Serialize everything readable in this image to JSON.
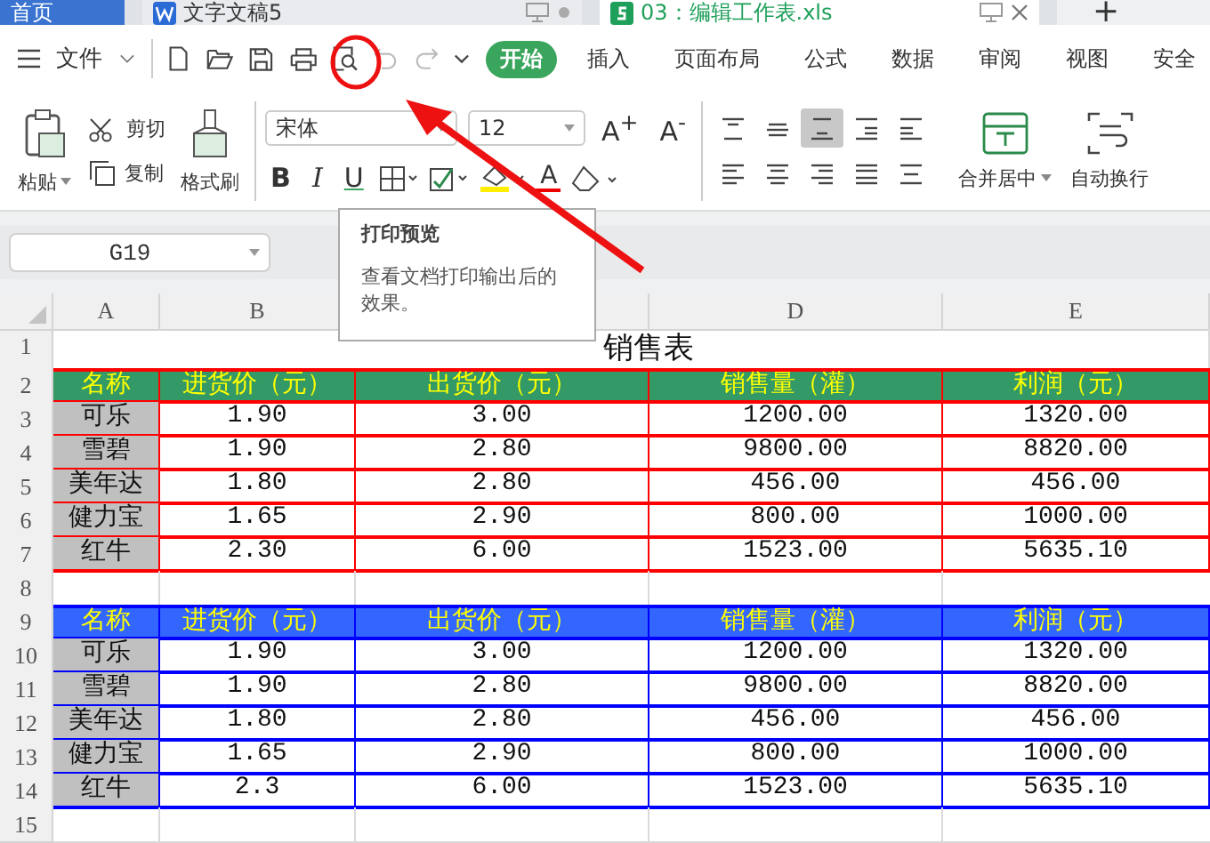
{
  "tabs": [
    {
      "label": "首页",
      "kind": "home",
      "selected": false
    },
    {
      "label": "文字文稿5",
      "kind": "writer",
      "selected": false
    },
    {
      "label": "03：编辑工作表.xls",
      "kind": "sheet",
      "selected": true
    }
  ],
  "new_tab": "+",
  "menu": {
    "label": "文件"
  },
  "ribbon_tabs": [
    {
      "label": "开始",
      "selected": true
    },
    {
      "label": "插入",
      "selected": false
    },
    {
      "label": "页面布局",
      "selected": false
    },
    {
      "label": "公式",
      "selected": false
    },
    {
      "label": "数据",
      "selected": false
    },
    {
      "label": "审阅",
      "selected": false
    },
    {
      "label": "视图",
      "selected": false
    },
    {
      "label": "安全",
      "selected": false
    }
  ],
  "clipboard": {
    "paste": "粘贴",
    "cut": "剪切",
    "copy": "复制",
    "format_painter": "格式刷"
  },
  "font": {
    "name": "宋体",
    "size": "12",
    "grow": "A$^{+}$",
    "shrink": "A$^{-}$",
    "bold": "B",
    "italic": "I",
    "underline": "U",
    "font_color": "A"
  },
  "align_buttons": [
    {
      "kind": "top",
      "selected": false
    },
    {
      "kind": "middle",
      "selected": false
    },
    {
      "kind": "bottom",
      "selected": true
    },
    {
      "kind": "outdent",
      "selected": false
    },
    {
      "kind": "indent",
      "selected": false
    },
    {
      "kind": "left",
      "selected": false
    },
    {
      "kind": "center",
      "selected": false
    },
    {
      "kind": "right",
      "selected": false
    },
    {
      "kind": "justify",
      "selected": false
    },
    {
      "kind": "distributed",
      "selected": false
    }
  ],
  "merge": "合并居中",
  "wrap": "自动换行",
  "name_box": "G19",
  "tooltip": {
    "title": "打印预览",
    "text": "查看文档打印输出后的效果。"
  },
  "columns": [
    {
      "label": "A"
    },
    {
      "label": "B"
    },
    {},
    {
      "label": "D"
    },
    {
      "label": "E"
    }
  ],
  "blocks": [
    {
      "kind": "title",
      "number": "1",
      "text": "销售表"
    },
    {
      "kind": "table",
      "color": "#ff0000",
      "header": {
        "number": "2",
        "color": "#339966",
        "cells": [
          "名称",
          "进货价（元）",
          "出货价（元）",
          "销售量（灌）",
          "利润（元）"
        ]
      },
      "rows": [
        {
          "number": "3",
          "cells": [
            "可乐",
            "1.90",
            "3.00",
            "1200.00",
            "1320.00"
          ]
        },
        {
          "number": "4",
          "cells": [
            "雪碧",
            "1.90",
            "2.80",
            "9800.00",
            "8820.00"
          ]
        },
        {
          "number": "5",
          "cells": [
            "美年达",
            "1.80",
            "2.80",
            "456.00",
            "456.00"
          ]
        },
        {
          "number": "6",
          "cells": [
            "健力宝",
            "1.65",
            "2.90",
            "800.00",
            "1000.00"
          ]
        },
        {
          "number": "7",
          "cells": [
            "红牛",
            "2.30",
            "6.00",
            "1523.00",
            "5635.10"
          ]
        }
      ]
    },
    {
      "kind": "blank",
      "number": "8"
    },
    {
      "kind": "table",
      "color": "#0000ff",
      "header": {
        "number": "9",
        "color": "#3366ff",
        "cells": [
          "名称",
          "进货价（元）",
          "出货价（元）",
          "销售量（灌）",
          "利润（元）"
        ]
      },
      "rows": [
        {
          "number": "10",
          "cells": [
            "可乐",
            "1.90",
            "3.00",
            "1200.00",
            "1320.00"
          ]
        },
        {
          "number": "11",
          "cells": [
            "雪碧",
            "1.90",
            "2.80",
            "9800.00",
            "8820.00"
          ]
        },
        {
          "number": "12",
          "cells": [
            "美年达",
            "1.80",
            "2.80",
            "456.00",
            "456.00"
          ]
        },
        {
          "number": "13",
          "cells": [
            "健力宝",
            "1.65",
            "2.90",
            "800.00",
            "1000.00"
          ]
        },
        {
          "number": "14",
          "cells": [
            "红牛",
            "2.3",
            "6.00",
            "1523.00",
            "5635.10"
          ]
        }
      ]
    },
    {
      "kind": "blank",
      "number": "15"
    }
  ]
}
